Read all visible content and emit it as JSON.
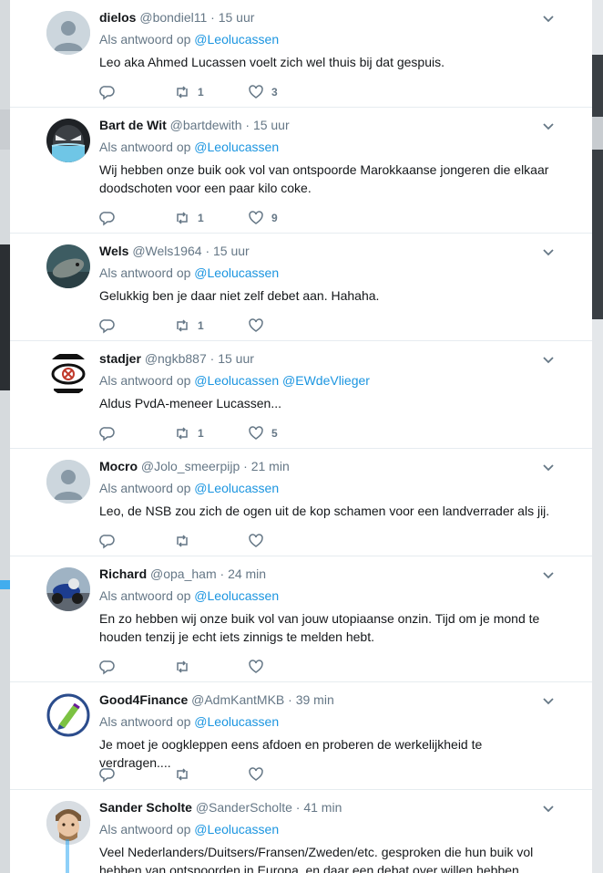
{
  "tweets": [
    {
      "name": "dielos",
      "handle": "@bondiel11",
      "time": "15 uur",
      "reply_prefix": "Als antwoord op",
      "mentions": [
        "@Leolucassen"
      ],
      "text": "Leo aka Ahmed Lucassen  voelt zich wel thuis bij dat gespuis.",
      "retweets": "1",
      "likes": "3",
      "avatar": "default-avatar"
    },
    {
      "name": "Bart de Wit",
      "handle": "@bartdewith",
      "time": "15 uur",
      "reply_prefix": "Als antwoord op",
      "mentions": [
        "@Leolucassen"
      ],
      "text": "Wij hebben onze buik ook vol van ontspoorde Marokkaanse jongeren die elkaar doodschoten voor een paar kilo coke.",
      "retweets": "1",
      "likes": "9",
      "avatar": "masked-face-avatar"
    },
    {
      "name": "Wels",
      "handle": "@Wels1964",
      "time": "15 uur",
      "reply_prefix": "Als antwoord op",
      "mentions": [
        "@Leolucassen"
      ],
      "text": "Gelukkig ben je daar niet zelf debet aan. Hahaha.",
      "retweets": "1",
      "likes": "",
      "avatar": "fish-avatar"
    },
    {
      "name": "stadjer",
      "handle": "@ngkb887",
      "time": "15 uur",
      "reply_prefix": "Als antwoord op",
      "mentions": [
        "@Leolucassen",
        "@EWdeVlieger"
      ],
      "text": "Aldus PvdA-meneer Lucassen...",
      "retweets": "1",
      "likes": "5",
      "avatar": "eye-logo-avatar"
    },
    {
      "name": "Mocro",
      "handle": "@Jolo_smeerpijp",
      "time": "21 min",
      "reply_prefix": "Als antwoord op",
      "mentions": [
        "@Leolucassen"
      ],
      "text": "Leo, de NSB zou zich de ogen uit de kop schamen voor een landverrader als jij.",
      "retweets": "",
      "likes": "",
      "avatar": "default-avatar"
    },
    {
      "name": "Richard",
      "handle": "@opa_ham",
      "time": "24 min",
      "reply_prefix": "Als antwoord op",
      "mentions": [
        "@Leolucassen"
      ],
      "text": "En zo hebben wij onze buik vol van jouw utopiaanse onzin. Tijd om je mond te houden tenzij je echt iets zinnigs te melden hebt.",
      "retweets": "",
      "likes": "",
      "avatar": "motorbike-avatar"
    },
    {
      "name": "Good4Finance",
      "handle": "@AdmKantMKB",
      "time": "39 min",
      "reply_prefix": "Als antwoord op",
      "mentions": [
        "@Leolucassen"
      ],
      "text": "Je moet je oogkleppen eens afdoen en proberen de werkelijkheid te verdragen....",
      "retweets": "",
      "likes": "",
      "avatar": "pen-logo-avatar"
    },
    {
      "name": "Sander Scholte",
      "handle": "@SanderScholte",
      "time": "41 min",
      "reply_prefix": "Als antwoord op",
      "mentions": [
        "@Leolucassen"
      ],
      "text": "Veel Nederlanders/Duitsers/Fransen/Zweden/etc. gesproken die hun buik vol hebben van ontspoorden in Europa, en daar een debat over willen hebben",
      "retweets": "",
      "likes": "",
      "avatar": "face-photo-avatar"
    }
  ],
  "colors": {
    "link": "#1b95e0",
    "muted": "#657786",
    "text": "#14171a",
    "divider": "#e6ecf0"
  }
}
